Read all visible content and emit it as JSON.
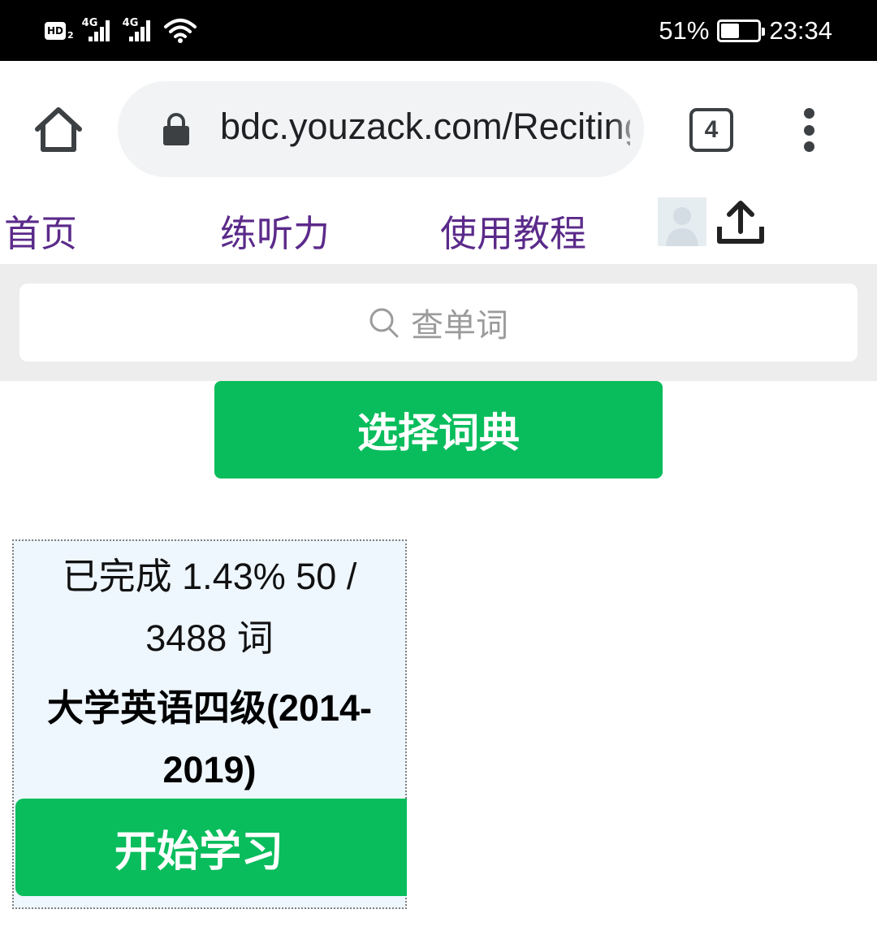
{
  "status_bar": {
    "hd_label": "HD",
    "hd_sub": "2",
    "sim1_network": "4G",
    "sim2_network": "4G",
    "battery_percent": "51%",
    "battery_level": 0.51,
    "time": "23:34",
    "icons": [
      "hd-icon",
      "signal-icon",
      "signal-icon",
      "wifi-icon",
      "battery-icon"
    ]
  },
  "browser": {
    "url": "bdc.youzack.com/RecitingWord",
    "tab_count": "4",
    "icons": [
      "home-icon",
      "lock-icon",
      "tab-switcher-icon",
      "more-vert-icon"
    ]
  },
  "nav": {
    "home": "首页",
    "listening": "练听力",
    "tutorial": "使用教程",
    "icons": [
      "avatar",
      "upload-icon"
    ]
  },
  "search": {
    "placeholder": "查单词",
    "icon": "search-icon"
  },
  "select_dictionary": "选择词典",
  "book_card": {
    "progress": "已完成 1.43% 50 / 3488 词",
    "title": "大学英语四级(2014-2019)",
    "start_button": "开始学习"
  },
  "colors": {
    "accent_green": "#09bd5c",
    "nav_link": "#5b2a8a",
    "card_bg": "#eef6fe"
  }
}
